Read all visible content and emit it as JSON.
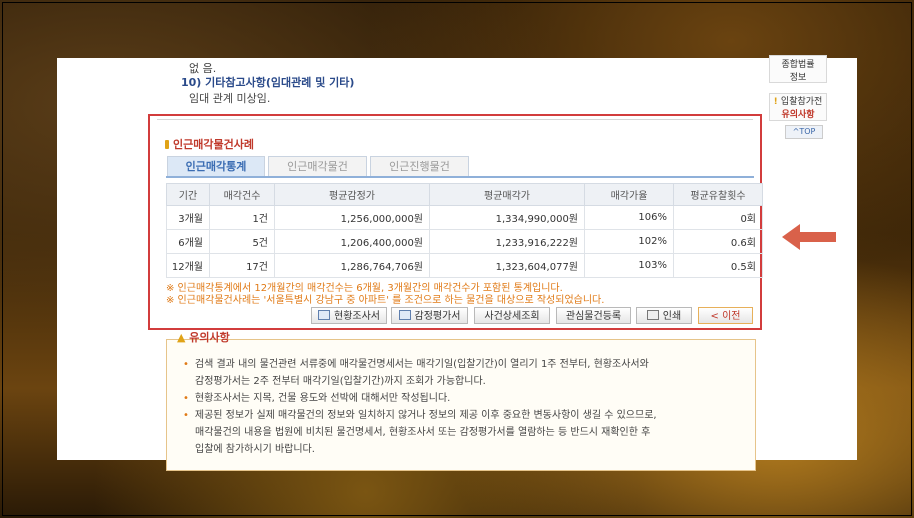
{
  "top": {
    "line1": "없 음.",
    "heading10": "10) 기타참고사항(임대관례 및 기타)",
    "line2": "임대 관계 미상임."
  },
  "right_panel": {
    "law_info": [
      "종합법률",
      "정보"
    ],
    "caution_prefix": "입찰참가전",
    "caution": "유의사항",
    "top_label": "^TOP"
  },
  "section": {
    "title": "인근매각물건사례",
    "tabs": [
      "인근매각통계",
      "인근매각물건",
      "인근진행물건"
    ]
  },
  "table": {
    "headers": [
      "기간",
      "매각건수",
      "평균감정가",
      "평균매각가",
      "매각가율",
      "평균유찰횟수"
    ],
    "rows": [
      [
        "3개월",
        "1건",
        "1,256,000,000원",
        "1,334,990,000원",
        "106%",
        "0회"
      ],
      [
        "6개월",
        "5건",
        "1,206,400,000원",
        "1,233,916,222원",
        "102%",
        "0.6회"
      ],
      [
        "12개월",
        "17건",
        "1,286,764,706원",
        "1,323,604,077원",
        "103%",
        "0.5회"
      ]
    ]
  },
  "notes": [
    "※ 인근매각통계에서 12개월간의 매각건수는 6개월, 3개월간의 매각건수가 포함된 통계입니다.",
    "※ 인근매각물건사례는 '서울특별시 강남구 중 아파트' 를 조건으로 하는 물건을 대상으로 작성되었습니다."
  ],
  "buttons": {
    "survey": "현황조사서",
    "appraisal": "감정평가서",
    "case_detail": "사건상세조회",
    "interest": "관심물건등록",
    "print": "인쇄",
    "prev": "< 이전"
  },
  "caution_section": {
    "title": "유의사항",
    "items": [
      [
        "검색 결과 내의 물건관련 서류중에 매각물건명세서는 매각기일(입찰기간)이 열리기 1주 전부터, 현황조사서와",
        "감정평가서는 2주 전부터 매각기일(입찰기간)까지 조회가 가능합니다."
      ],
      [
        "현황조사서는 지목, 건물 용도와 선박에 대해서만 작성됩니다."
      ],
      [
        "제공된 정보가 실제 매각물건의 정보와 일치하지 않거나 정보의 제공 이후 중요한 변동사항이 생길 수 있으므로,",
        "매각물건의 내용을 법원에 비치된 물건명세서, 현황조사서 또는 감정평가서를 열람하는 등 반드시 재확인한 후",
        "입찰에 참가하시기 바랍니다."
      ]
    ]
  },
  "colors": {
    "highlight_border": "#d23c3c",
    "arrow": "#d9614a",
    "accent_orange": "#e07a16",
    "tab_active": "#3b6db3"
  }
}
